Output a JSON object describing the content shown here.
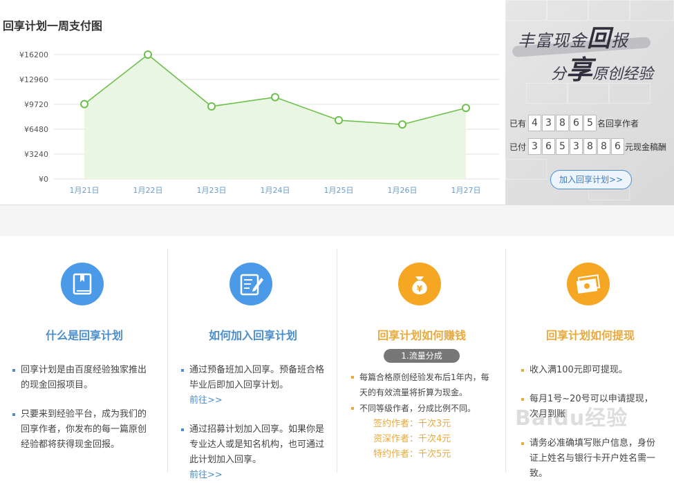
{
  "chart_title": "回享计划一周支付图",
  "chart_data": {
    "type": "area",
    "title": "回享计划一周支付图",
    "categories": [
      "1月21日",
      "1月22日",
      "1月23日",
      "1月24日",
      "1月25日",
      "1月26日",
      "1月27日"
    ],
    "values": [
      9750,
      16200,
      9450,
      10650,
      7650,
      7100,
      9250
    ],
    "yticks": [
      "¥0",
      "¥3240",
      "¥6480",
      "¥9720",
      "¥12960",
      "¥16200"
    ],
    "ylim": [
      0,
      16200
    ],
    "line_color": "#6cc04a",
    "fill_color": "#e9f6e4",
    "grid": true
  },
  "panel": {
    "slogan_line1_a": "丰富现金",
    "slogan_line1_big": "回",
    "slogan_line1_b": "报",
    "slogan_line2_a": "分",
    "slogan_line2_big": "享",
    "slogan_line2_b": "原创经验",
    "authors_prefix": "已有",
    "authors_digits": [
      "4",
      "3",
      "8",
      "6",
      "5"
    ],
    "authors_suffix": "名回享作者",
    "paid_prefix": "已付",
    "paid_digits": [
      "3",
      "6",
      "5",
      "3",
      "8",
      "8",
      "6"
    ],
    "paid_suffix": "元现金稿酬",
    "join_button": "加入回享计划>>"
  },
  "columns": [
    {
      "title": "什么是回享计划",
      "items": [
        "回享计划是由百度经验独家推出的现金回报项目。",
        "只要来到经验平台，成为我们的回享作者，你发布的每一篇原创经验都将获得现金回报。"
      ]
    },
    {
      "title": "如何加入回享计划",
      "items": [
        "通过预备班加入回享。预备班合格毕业后即加入回享计划。",
        "通过招募计划加入回享。如果你是专业达人或是知名机构，也可通过此计划加入回享。"
      ],
      "link": "前往>>"
    },
    {
      "title": "回享计划如何赚钱",
      "pill": "1.流量分成",
      "items": [
        "每篇合格原创经验发布后1年内，每天的有效流量将折算为现金。",
        "不同等级作者，分成比例不同。"
      ],
      "tiers": [
        "签约作者：千次3元",
        "资深作者：千次4元",
        "特约作者：千次5元"
      ]
    },
    {
      "title": "回享计划如何提现",
      "items": [
        "收入满100元即可提现。",
        "每月1号~20号可以申请提现，次月到账",
        "请务必准确填写账户信息，身份证上姓名与银行卡开户姓名需一致。"
      ]
    }
  ],
  "colors": {
    "blue": "#4a8ecb",
    "orange": "#f5a623",
    "icon_blue": "#4a9ae8"
  },
  "watermark": "Baidu经验"
}
